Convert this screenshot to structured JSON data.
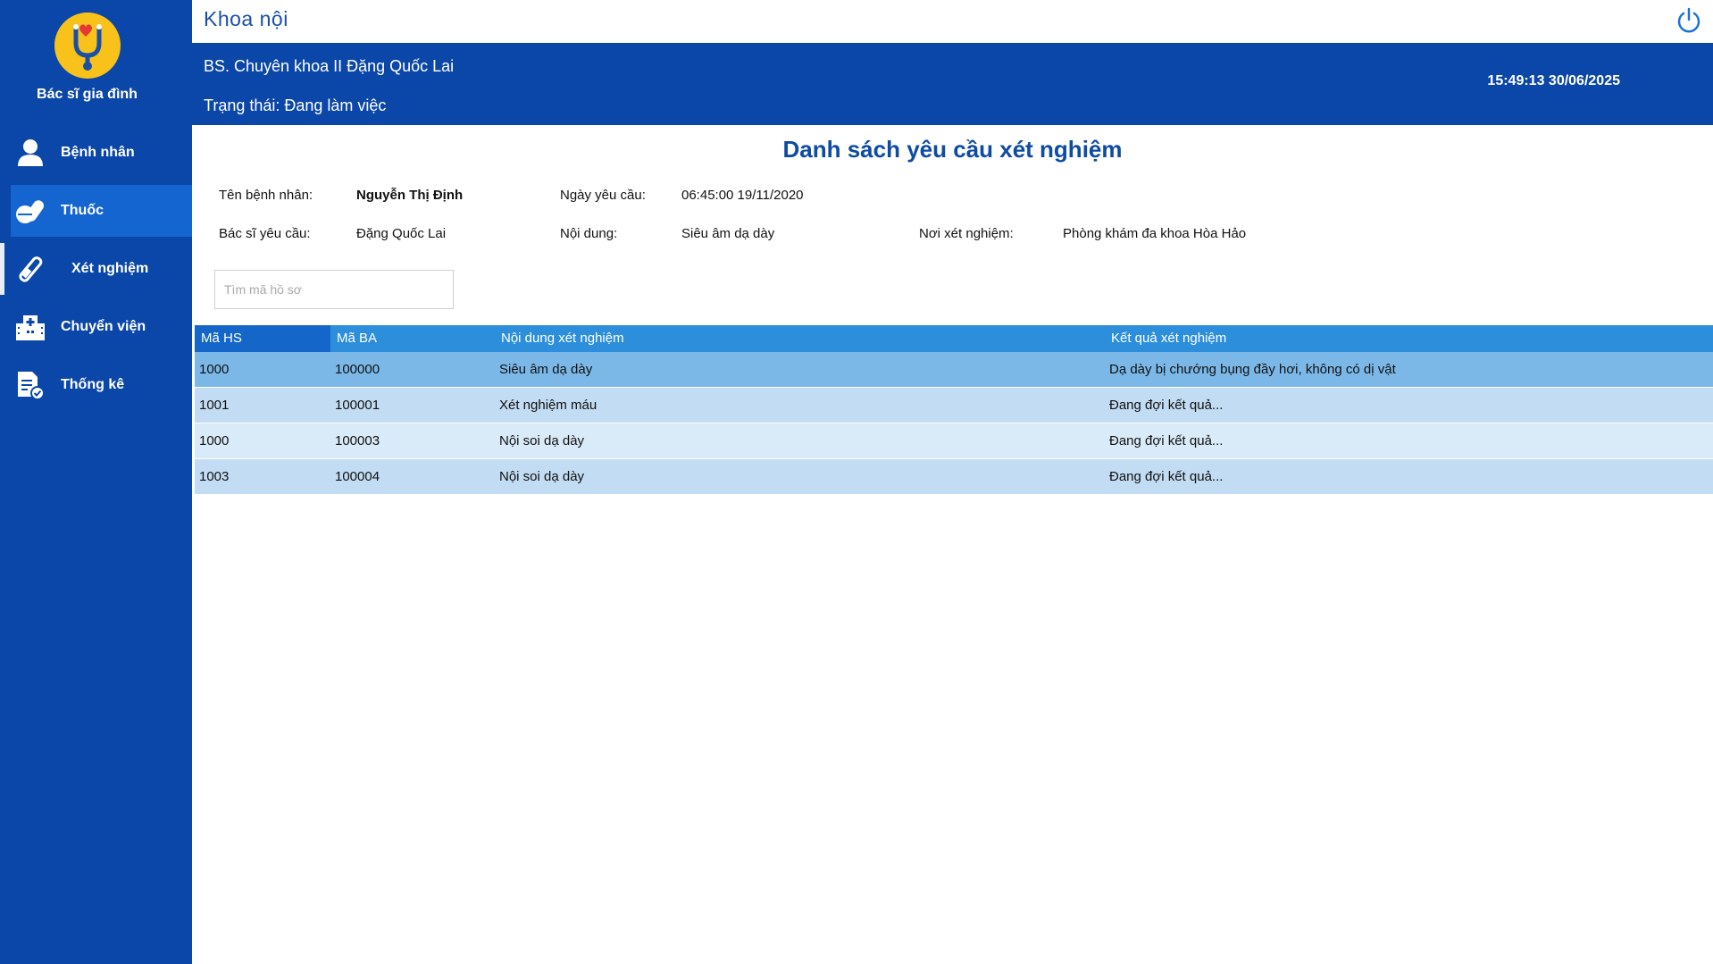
{
  "app": {
    "name": "Bác sĩ gia đình"
  },
  "sidebar": {
    "items": [
      {
        "label": "Bệnh nhân",
        "icon": "user-icon"
      },
      {
        "label": "Thuốc",
        "icon": "pills-icon"
      },
      {
        "label": "Xét nghiệm",
        "icon": "test-tube-icon"
      },
      {
        "label": "Chuyển viện",
        "icon": "hospital-icon"
      },
      {
        "label": "Thống kê",
        "icon": "report-icon"
      }
    ]
  },
  "window": {
    "title": "Khoa nội"
  },
  "infobar": {
    "doctor": "BS. Chuyên khoa II Đặng Quốc Lai",
    "status": "Trạng thái: Đang làm việc",
    "clock": "15:49:13 30/06/2025"
  },
  "page": {
    "title": "Danh sách yêu cầu xét nghiệm"
  },
  "details": {
    "patient_label": "Tên bệnh nhân:",
    "patient_value": "Nguyễn Thị Định",
    "request_date_label": "Ngày yêu cầu:",
    "request_date_value": "06:45:00 19/11/2020",
    "doctor_label": "Bác sĩ yêu cầu:",
    "doctor_value": "Đặng Quốc Lai",
    "content_label": "Nội dung:",
    "content_value": "Siêu âm dạ dày",
    "place_label": "Nơi xét nghiệm:",
    "place_value": "Phòng khám đa khoa Hòa Hảo"
  },
  "search": {
    "placeholder": "Tìm mã hồ sơ",
    "value": ""
  },
  "table": {
    "columns": [
      "Mã HS",
      "Mã BA",
      "Nội dung xét nghiệm",
      "Kết quả xét nghiệm"
    ],
    "rows": [
      [
        "1000",
        "100000",
        "Siêu âm dạ dày",
        "Dạ dày bị chướng bụng đầy hơi, không có dị vật"
      ],
      [
        "1001",
        "100001",
        "Xét nghiệm máu",
        "Đang đợi kết quả..."
      ],
      [
        "1000",
        "100003",
        "Nội soi dạ dày",
        "Đang đợi kết quả..."
      ],
      [
        "1003",
        "100004",
        "Nội soi dạ dày",
        "Đang đợi kết quả..."
      ]
    ]
  },
  "colors": {
    "primary": "#0b47a8",
    "header": "#2d8fdc",
    "title": "#0e4ba3",
    "accent": "#f8c21a"
  }
}
